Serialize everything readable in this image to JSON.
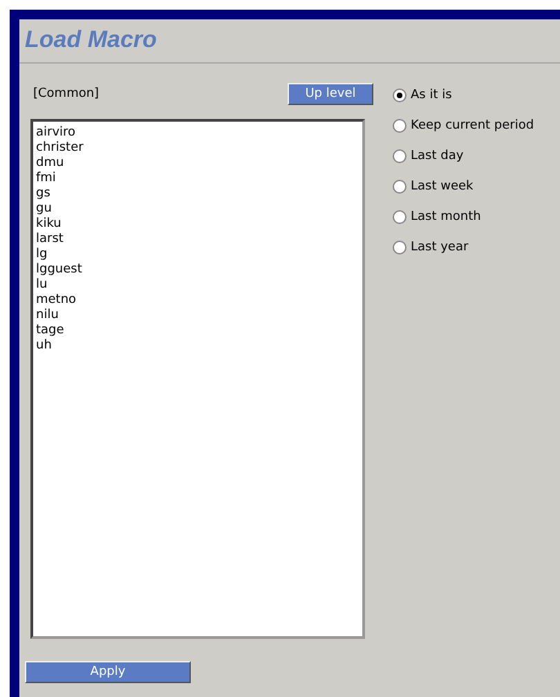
{
  "title": "Load Macro",
  "folder": "[Common]",
  "up_button": "Up level",
  "list_items": [
    "airviro",
    "christer",
    "dmu",
    "fmi",
    "gs",
    "gu",
    "kiku",
    "larst",
    "lg",
    "lgguest",
    "lu",
    "metno",
    "nilu",
    "tage",
    "uh"
  ],
  "period_options": [
    {
      "label": "As it is",
      "selected": true
    },
    {
      "label": "Keep current period",
      "selected": false
    },
    {
      "label": "Last day",
      "selected": false
    },
    {
      "label": "Last week",
      "selected": false
    },
    {
      "label": "Last month",
      "selected": false
    },
    {
      "label": "Last year",
      "selected": false
    }
  ],
  "apply_button": "Apply"
}
